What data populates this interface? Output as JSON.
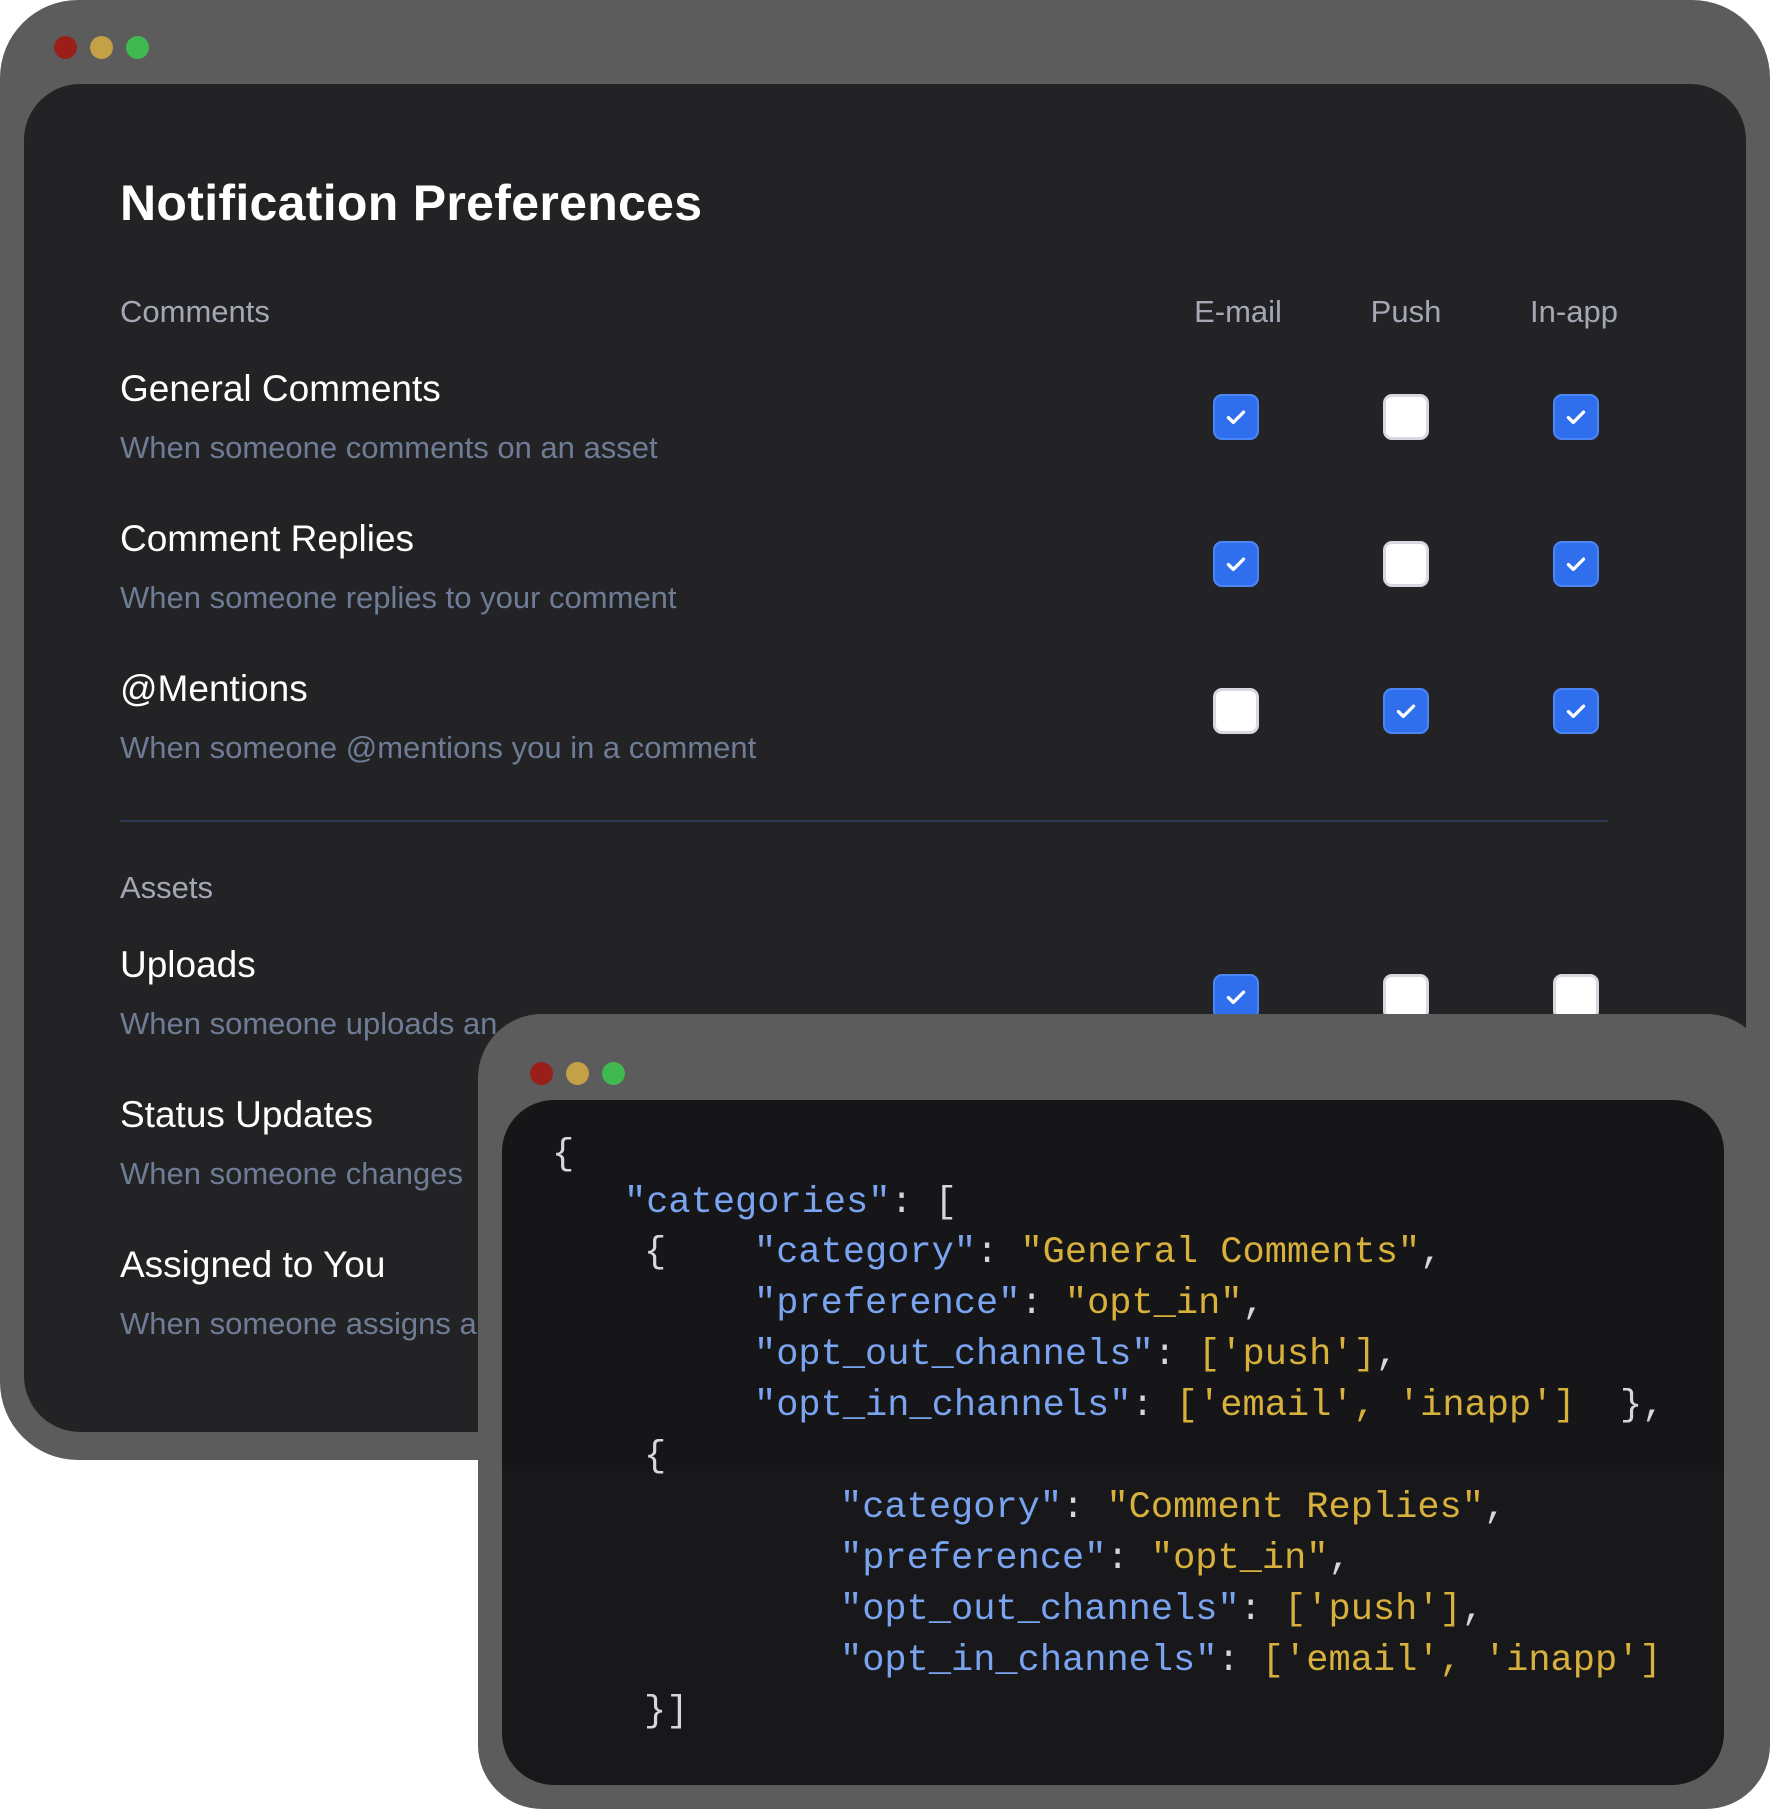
{
  "preferences": {
    "title": "Notification Preferences",
    "channels": [
      "E-mail",
      "Push",
      "In-app"
    ],
    "sections": [
      {
        "label": "Comments",
        "rows": [
          {
            "title": "General Comments",
            "description": "When someone comments on an asset",
            "email": true,
            "push": false,
            "inapp": true
          },
          {
            "title": "Comment Replies",
            "description": "When someone replies to your comment",
            "email": true,
            "push": false,
            "inapp": true
          },
          {
            "title": "@Mentions",
            "description": "When someone @mentions you in a comment",
            "email": false,
            "push": true,
            "inapp": true
          }
        ]
      },
      {
        "label": "Assets",
        "rows": [
          {
            "title": "Uploads",
            "description": "When someone uploads an",
            "email": true,
            "push": false,
            "inapp": false
          },
          {
            "title": "Status Updates",
            "description": "When someone changes"
          },
          {
            "title": "Assigned to You",
            "description": "When someone assigns a"
          }
        ]
      }
    ]
  },
  "code": {
    "open_brace": "{",
    "categories_key": "\"categories\"",
    "entries": [
      {
        "category_key": "\"category\"",
        "category_value": "\"General Comments\"",
        "preference_key": "\"preference\"",
        "preference_value": "\"opt_in\"",
        "opt_out_key": "\"opt_out_channels\"",
        "opt_out_value": "['push']",
        "opt_in_key": "\"opt_in_channels\"",
        "opt_in_value": "['email', 'inapp']"
      },
      {
        "category_key": "\"category\"",
        "category_value": "\"Comment Replies\"",
        "preference_key": "\"preference\"",
        "preference_value": "\"opt_in\"",
        "opt_out_key": "\"opt_out_channels\"",
        "opt_out_value": "['push']",
        "opt_in_key": "\"opt_in_channels\"",
        "opt_in_value": "['email', 'inapp']"
      }
    ],
    "close": "}]"
  },
  "colors": {
    "accent": "#2f6fee",
    "code_key": "#7aa3f0",
    "code_string": "#d8b13c",
    "red_light": "#9a1f1b",
    "yellow_light": "#c4a047",
    "green_light": "#3fb950"
  }
}
